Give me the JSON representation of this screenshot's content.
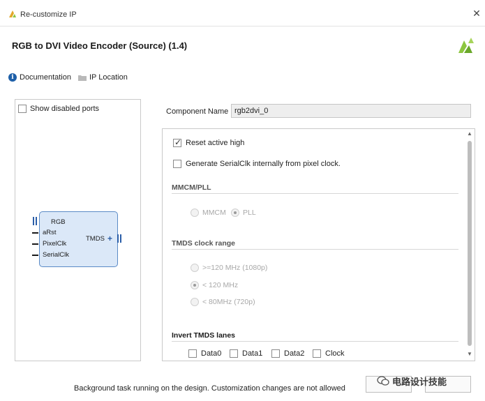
{
  "window": {
    "title": "Re-customize IP",
    "close_glyph": "✕"
  },
  "header": {
    "ip_title": "RGB to DVI Video Encoder (Source) (1.4)"
  },
  "links": {
    "documentation": "Documentation",
    "ip_location": "IP Location"
  },
  "left_pane": {
    "show_disabled_ports": "Show disabled ports",
    "show_disabled_checked": false,
    "block": {
      "inputs": [
        "RGB",
        "aRst",
        "PixelClk",
        "SerialClk"
      ],
      "output": "TMDS"
    }
  },
  "component": {
    "label": "Component Name",
    "value": "rgb2dvi_0"
  },
  "options": {
    "reset_active_high": {
      "label": "Reset active high",
      "checked": true
    },
    "gen_serialclk": {
      "label": "Generate SerialClk internally from pixel clock.",
      "checked": false
    }
  },
  "mmcm_pll": {
    "heading": "MMCM/PLL",
    "options": [
      "MMCM",
      "PLL"
    ],
    "selected": "PLL"
  },
  "tmds_range": {
    "heading": "TMDS clock range",
    "options": [
      ">=120 MHz (1080p)",
      "< 120 MHz",
      "< 80MHz (720p)"
    ],
    "selected": "< 120 MHz"
  },
  "invert_lanes": {
    "heading": "Invert TMDS lanes",
    "lanes": [
      "Data0",
      "Data1",
      "Data2",
      "Clock"
    ]
  },
  "footer": {
    "status": "Background task running on the design. Customization changes are not allowed"
  },
  "watermark": {
    "text": "电路设计技能"
  },
  "colors": {
    "accent": "#1d5fa8",
    "block_fill": "#dbe8f8",
    "block_border": "#5a8ac6",
    "logo_green": "#8cc63f"
  }
}
